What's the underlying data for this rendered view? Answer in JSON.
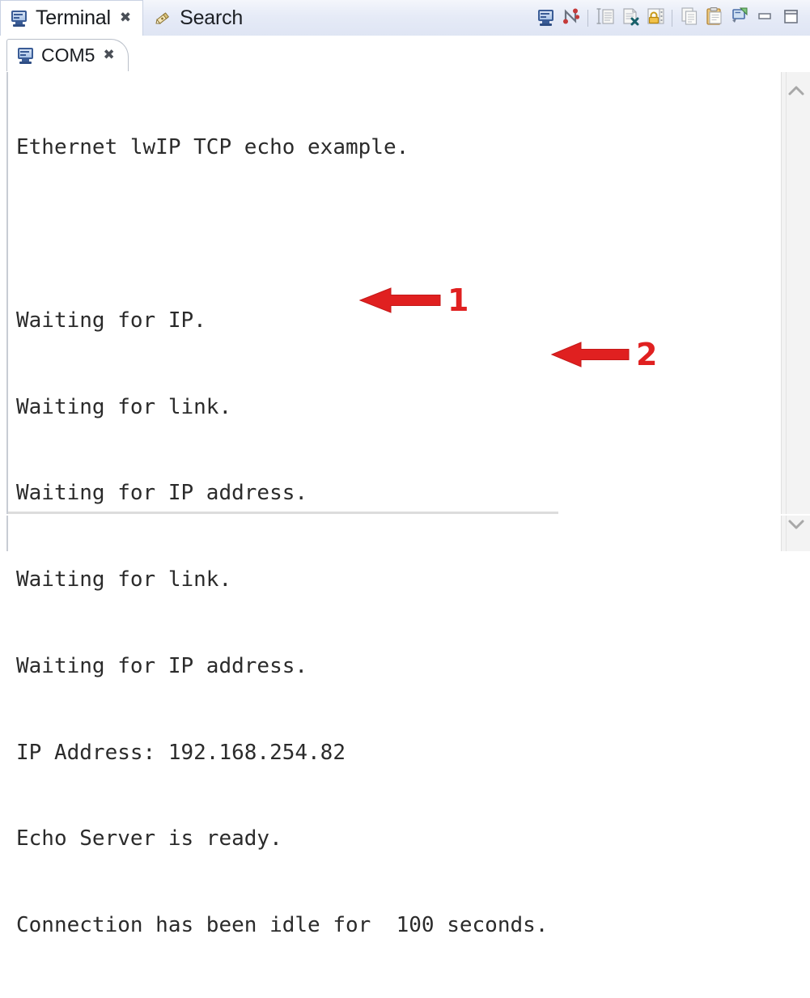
{
  "window": {
    "accent_blue": "#3a5c96",
    "header_bg": "#e6ebf7",
    "annotation_red": "#e02020"
  },
  "view_tabs": [
    {
      "label": "Terminal",
      "icon": "terminal-monitor-icon",
      "active": true,
      "close_glyph": "✖"
    },
    {
      "label": "Search",
      "icon": "search-pen-icon",
      "active": false
    }
  ],
  "toolbar": {
    "buttons": [
      {
        "name": "display-selected-console-button",
        "icon": "monitor-icon",
        "enabled": true
      },
      {
        "name": "pin-console-button",
        "icon": "pin-scroll-icon",
        "enabled": true
      },
      {
        "name": "word-wrap-button",
        "icon": "word-wrap-icon",
        "enabled": false
      },
      {
        "name": "clear-console-button",
        "icon": "clear-document-icon",
        "enabled": false
      },
      {
        "name": "lock-console-button",
        "icon": "lock-icon",
        "enabled": true
      },
      {
        "name": "copy-button",
        "icon": "copy-icon",
        "enabled": false
      },
      {
        "name": "paste-button",
        "icon": "paste-clipboard-icon",
        "enabled": true
      },
      {
        "name": "new-terminal-button",
        "icon": "new-terminal-icon",
        "enabled": true
      }
    ],
    "window_controls": [
      {
        "name": "minimize-button",
        "icon": "minimize-icon"
      },
      {
        "name": "maximize-button",
        "icon": "maximize-icon"
      }
    ]
  },
  "editor": {
    "tab": {
      "label": "COM5",
      "icon": "terminal-monitor-icon",
      "close_glyph": "✖"
    }
  },
  "console": {
    "lines": [
      "Ethernet lwIP TCP echo example.",
      "",
      "Waiting for IP.",
      "Waiting for link.",
      "Waiting for IP address.",
      "Waiting for link.",
      "Waiting for IP address.",
      "IP Address: 192.168.254.82",
      "Echo Server is ready.",
      "Connection has been idle for  100 seconds."
    ],
    "ip_address": "192.168.254.82",
    "idle_seconds": "100"
  },
  "annotations": [
    {
      "label": "1",
      "target_line": "IP Address: 192.168.254.82",
      "direction": "left"
    },
    {
      "label": "2",
      "target_line": "Connection has been idle for  100 seconds.",
      "direction": "left"
    }
  ],
  "scrollbars": {
    "vertical": {
      "up_arrow": "chevron-up-icon",
      "down_arrow": "chevron-down-icon"
    },
    "horizontal": {
      "present": true
    }
  }
}
